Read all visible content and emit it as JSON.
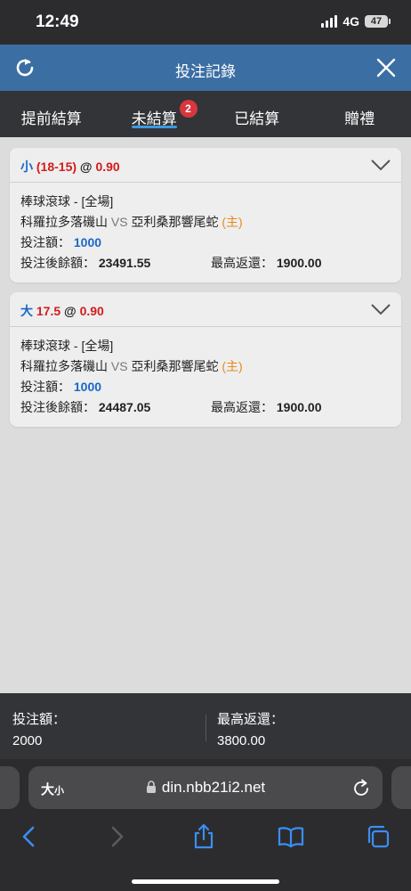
{
  "status_bar": {
    "time": "12:49",
    "network": "4G",
    "battery": "47"
  },
  "header": {
    "title": "投注記錄",
    "refresh_icon": "refresh-icon",
    "close_icon": "close-icon"
  },
  "tabs": [
    {
      "label": "提前結算",
      "active": false
    },
    {
      "label": "未結算",
      "active": true,
      "badge": "2"
    },
    {
      "label": "已結算",
      "active": false
    },
    {
      "label": "贈禮",
      "active": false
    }
  ],
  "bets": [
    {
      "selection": "小",
      "line": "(18-15)",
      "at": "@",
      "odds": "0.90",
      "league": "棒球滾球 - [全場]",
      "team_home": "科羅拉多落磯山",
      "vs": "VS",
      "team_away": "亞利桑那響尾蛇",
      "home_mark": "(主)",
      "stake_label": "投注額：",
      "stake": "1000",
      "balance_label": "投注後餘額：",
      "balance": "23491.55",
      "max_return_label": "最高返還：",
      "max_return": "1900.00"
    },
    {
      "selection": "大",
      "line": "17.5",
      "at": "@",
      "odds": "0.90",
      "league": "棒球滾球 - [全場]",
      "team_home": "科羅拉多落磯山",
      "vs": "VS",
      "team_away": "亞利桑那響尾蛇",
      "home_mark": "(主)",
      "stake_label": "投注額：",
      "stake": "1000",
      "balance_label": "投注後餘額：",
      "balance": "24487.05",
      "max_return_label": "最高返還：",
      "max_return": "1900.00"
    }
  ],
  "summary": {
    "stake_label": "投注額：",
    "stake_total": "2000",
    "return_label": "最高返還：",
    "return_total": "3800.00"
  },
  "browser": {
    "text_size_big": "大",
    "text_size_small": "小",
    "url": "din.nbb21i2.net"
  },
  "colors": {
    "header": "#3b6ea3",
    "accent_blue": "#1967c8",
    "odds_red": "#d21c1c",
    "home_orange": "#e8891b",
    "badge_red": "#d9363e"
  }
}
